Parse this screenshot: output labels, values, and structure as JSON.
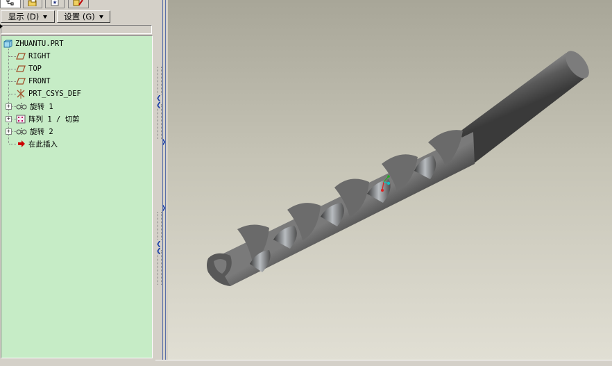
{
  "toolbar": {
    "show_label": "显示 (D)",
    "settings_label": "设置 (G)"
  },
  "model_tree": {
    "root": {
      "label": "ZHUANTU.PRT",
      "icon": "part-icon"
    },
    "items": [
      {
        "label": "RIGHT",
        "icon": "datum-plane-icon",
        "expandable": false
      },
      {
        "label": "TOP",
        "icon": "datum-plane-icon",
        "expandable": false
      },
      {
        "label": "FRONT",
        "icon": "datum-plane-icon",
        "expandable": false
      },
      {
        "label": "PRT_CSYS_DEF",
        "icon": "coordinate-system-icon",
        "expandable": false
      },
      {
        "label": "旋转 1",
        "icon": "revolve-feature-icon",
        "expandable": true
      },
      {
        "label": "阵列 1 / 切剪",
        "icon": "pattern-feature-icon",
        "expandable": true
      },
      {
        "label": "旋转 2",
        "icon": "revolve-feature-icon",
        "expandable": true
      },
      {
        "label": "在此插入",
        "icon": "insert-here-arrow-icon",
        "expandable": false
      }
    ]
  },
  "colors": {
    "tree_background": "#c6ecc6",
    "window_chrome": "#d4d0c8",
    "datum_plane": "#a0522d",
    "insert_arrow": "#cc0000",
    "model_gray": "#6a6a6a"
  },
  "viewport": {
    "model": "twist-drill",
    "csys_axes": [
      "x-red",
      "y-green",
      "z-cyan"
    ]
  }
}
